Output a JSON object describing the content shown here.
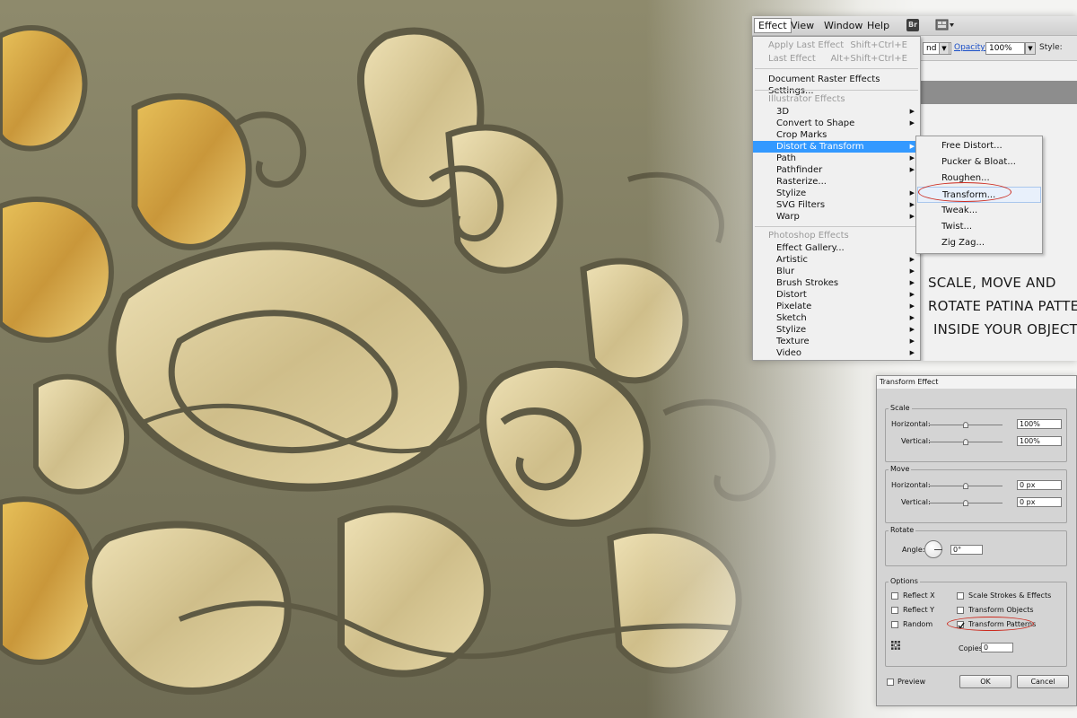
{
  "menubar": {
    "items": [
      "Effect",
      "View",
      "Window",
      "Help"
    ],
    "br_label": "Br"
  },
  "control_bar": {
    "blend_value": "nd",
    "opacity_label": "Opacity:",
    "opacity_value": "100%",
    "style_label": "Style:"
  },
  "effect_menu": {
    "apply_last_effect": {
      "label": "Apply Last Effect",
      "shortcut": "Shift+Ctrl+E"
    },
    "last_effect": {
      "label": "Last Effect",
      "shortcut": "Alt+Shift+Ctrl+E"
    },
    "document_raster": "Document Raster Effects Settings...",
    "illustrator_section": "Illustrator Effects",
    "illustrator_items": [
      "3D",
      "Convert to Shape",
      "Crop Marks",
      "Distort & Transform",
      "Path",
      "Pathfinder",
      "Rasterize...",
      "Stylize",
      "SVG Filters",
      "Warp"
    ],
    "photoshop_section": "Photoshop Effects",
    "photoshop_items": [
      "Effect Gallery...",
      "Artistic",
      "Blur",
      "Brush Strokes",
      "Distort",
      "Pixelate",
      "Sketch",
      "Stylize",
      "Texture",
      "Video"
    ]
  },
  "distort_submenu": {
    "items": [
      "Free Distort...",
      "Pucker & Bloat...",
      "Roughen...",
      "Transform...",
      "Tweak...",
      "Twist...",
      "Zig Zag..."
    ]
  },
  "caption": {
    "lines": [
      "Scale, move and",
      "rotate patina pattern",
      "inside your objects!"
    ]
  },
  "transform_dialog": {
    "title": "Transform Effect",
    "scale": {
      "title": "Scale",
      "horizontal_label": "Horizontal:",
      "horizontal_value": "100%",
      "vertical_label": "Vertical:",
      "vertical_value": "100%"
    },
    "move": {
      "title": "Move",
      "horizontal_label": "Horizontal:",
      "horizontal_value": "0 px",
      "vertical_label": "Vertical:",
      "vertical_value": "0 px"
    },
    "rotate": {
      "title": "Rotate",
      "angle_label": "Angle:",
      "angle_value": "0°"
    },
    "options": {
      "title": "Options",
      "reflect_x": "Reflect X",
      "reflect_y": "Reflect Y",
      "random": "Random",
      "scale_strokes": "Scale Strokes & Effects",
      "transform_objects": "Transform Objects",
      "transform_patterns": "Transform Patterns",
      "transform_patterns_checked": true,
      "copies_label": "Copies",
      "copies_value": "0"
    },
    "preview_label": "Preview",
    "ok_label": "OK",
    "cancel_label": "Cancel"
  },
  "colors": {
    "highlight": "#3399ff",
    "annotation_ring": "#cc2a1e",
    "gold": "#c9a44a",
    "patina": "#7e7a5c"
  }
}
